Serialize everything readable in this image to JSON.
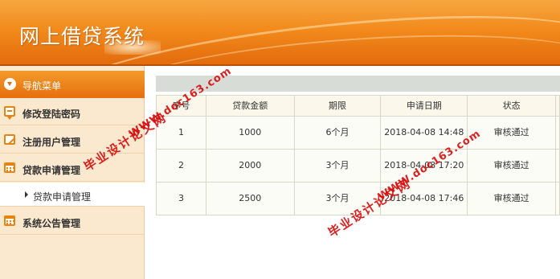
{
  "app": {
    "title": "网上借贷系统"
  },
  "sidebar": {
    "nav_header": "导航菜单",
    "items": [
      {
        "label": "修改登陆密码",
        "icon": "speech-bubble-icon"
      },
      {
        "label": "注册用户管理",
        "icon": "edit-icon"
      },
      {
        "label": "贷款申请管理",
        "icon": "calendar-icon"
      },
      {
        "label": "系统公告管理",
        "icon": "calendar-icon"
      }
    ],
    "submenu": [
      {
        "label": "贷款申请管理"
      }
    ]
  },
  "table": {
    "headers": [
      "序号",
      "贷款金额",
      "期限",
      "申请日期",
      "状态"
    ],
    "rows": [
      {
        "no": "1",
        "amount": "1000",
        "term": "6个月",
        "date": "2018-04-08 14:48",
        "status": "审核通过"
      },
      {
        "no": "2",
        "amount": "2000",
        "term": "3个月",
        "date": "2018-04-08 17:20",
        "status": "审核通过"
      },
      {
        "no": "3",
        "amount": "2500",
        "term": "3个月",
        "date": "2018-04-08 17:46",
        "status": "审核通过"
      }
    ]
  },
  "watermark": {
    "site": "WWW.doc163.com",
    "name": "毕业设计论文网"
  },
  "colors": {
    "header_orange": "#f28a1c",
    "nav_orange": "#e66f0d",
    "sidebar_bg": "#fbe9cf",
    "watermark_red": "#d80a0a"
  }
}
